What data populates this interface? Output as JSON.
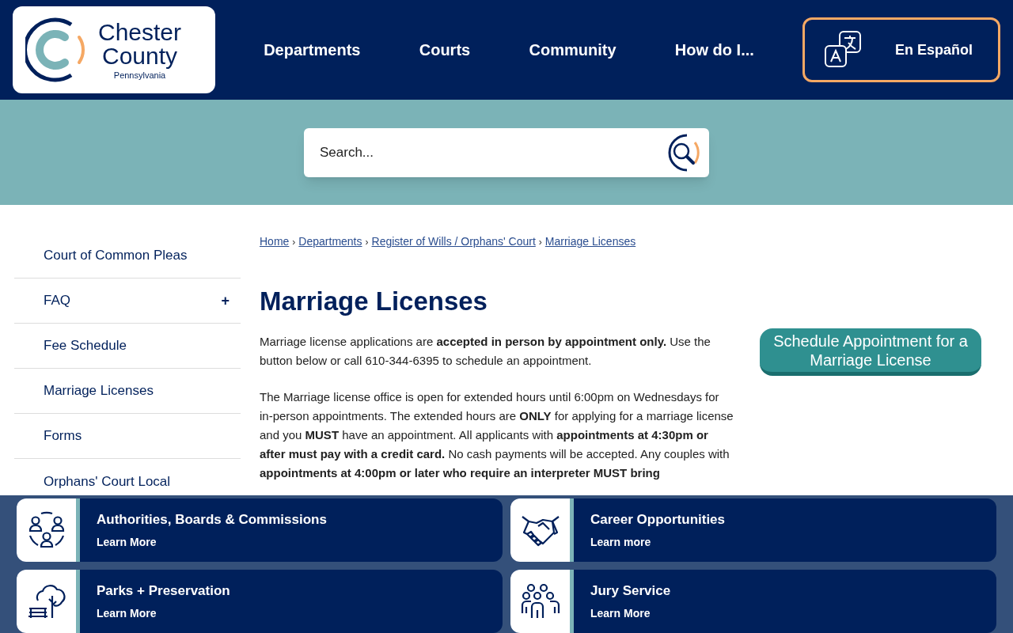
{
  "logo": {
    "name_line_1": "Chester",
    "name_line_2": "County",
    "state": "Pennsylvania"
  },
  "nav": [
    "Departments",
    "Courts",
    "Community",
    "How do I..."
  ],
  "language_button": "En Español",
  "search": {
    "placeholder": "Search..."
  },
  "sidebar": [
    {
      "label": "Court of Common Pleas"
    },
    {
      "label": "FAQ",
      "toggle": "+"
    },
    {
      "label": "Fee Schedule"
    },
    {
      "label": "Marriage Licenses"
    },
    {
      "label": "Forms"
    },
    {
      "label": "Orphans' Court Local"
    }
  ],
  "breadcrumb": [
    "Home",
    "Departments",
    "Register of Wills / Orphans' Court",
    "Marriage Licenses"
  ],
  "breadcrumb_separator": "›",
  "title": "Marriage Licenses",
  "paragraphs": [
    "Marriage license applications are **accepted in person by appointment only.** Use the button below or call  610-344-6395 to schedule an appointment.",
    "The Marriage license office is open for extended hours until 6:00pm on Wednesdays for in-person appointments. The extended hours are **ONLY** for applying for a marriage license and you **MUST** have an appointment. All applicants with **appointments at 4:30pm or after must pay with a credit card.** No cash payments will be accepted. Any couples with **appointments at 4:00pm or later who require an interpreter MUST bring**"
  ],
  "schedule_button": "Schedule Appointment for a Marriage License",
  "quick_links": [
    {
      "kind": "people",
      "title": "Authorities, Boards & Commissions",
      "link": "Learn More"
    },
    {
      "kind": "handshake",
      "title": "Career Opportunities",
      "link": "Learn more"
    },
    {
      "kind": "park",
      "title": "Parks + Preservation",
      "link": "Learn More"
    },
    {
      "kind": "group",
      "title": "Jury Service",
      "link": "Learn More"
    }
  ]
}
